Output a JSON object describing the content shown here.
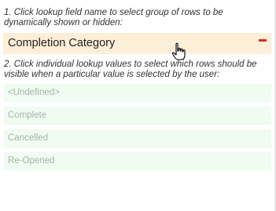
{
  "instructions": {
    "step1": "1. Click lookup field name to select group of rows to be dynamically shown or hidden:",
    "step2": "2. Click individual lookup values to select which rows should be visible when a particular value is selected by the user:"
  },
  "group": {
    "title": "Completion Category",
    "collapse_icon": "minus-icon"
  },
  "values": [
    {
      "label": "<Undefined>"
    },
    {
      "label": "Complete"
    },
    {
      "label": "Cancelled"
    },
    {
      "label": "Re-Opened"
    }
  ],
  "colors": {
    "group_bg": "#fdeed7",
    "value_bg": "#f0fbf1",
    "collapse": "#e0262a"
  }
}
